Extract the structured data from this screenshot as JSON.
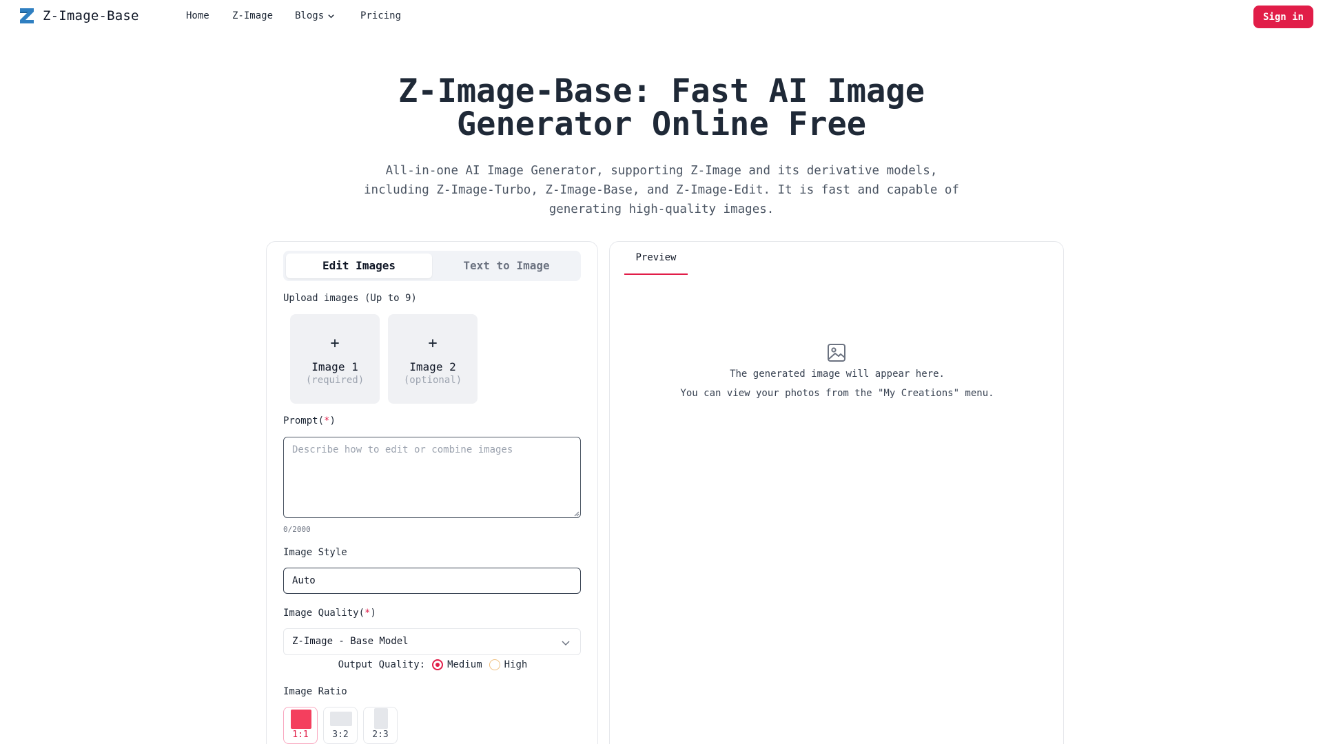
{
  "nav": {
    "brand": "Z-Image-Base",
    "links": [
      {
        "label": "Home"
      },
      {
        "label": "Z-Image"
      },
      {
        "label": "Blogs"
      },
      {
        "label": "Pricing"
      }
    ],
    "signin_label": "Sign in"
  },
  "hero": {
    "title_line1": "Z-Image-Base: Fast AI Image",
    "title_line2": "Generator Online Free",
    "subtitle_line1": "All-in-one AI Image Generator, supporting Z-Image and its derivative models,",
    "subtitle_line2": "including Z-Image-Turbo, Z-Image-Base, and Z-Image-Edit. It is fast and capable of",
    "subtitle_line3": "generating high-quality images."
  },
  "editor": {
    "tabs": [
      {
        "label": "Edit Images",
        "active": true
      },
      {
        "label": "Text to Image",
        "active": false
      }
    ],
    "upload_label": "Upload images (Up to 9)",
    "uploads": [
      {
        "plus": "+",
        "title": "Image 1",
        "note": "(required)"
      },
      {
        "plus": "+",
        "title": "Image 2",
        "note": "(optional)"
      }
    ],
    "prompt_label": "Prompt(",
    "prompt_req": "*",
    "prompt_label_end": ")",
    "prompt_value": "",
    "prompt_placeholder": "Describe how to edit or combine images",
    "prompt_counter": "0/2000",
    "style_label": "Image Style",
    "style_value": "Auto",
    "quality_label": "Image Quality(",
    "quality_req": "*",
    "quality_label_end": ")",
    "quality_value": "Z-Image - Base Model",
    "output_quality_label": "Output Quality:",
    "output_options": [
      {
        "label": "Medium",
        "selected": true
      },
      {
        "label": "High",
        "selected": false
      }
    ],
    "ratio_label": "Image Ratio",
    "ratios": [
      {
        "label": "1:1",
        "selected": true
      },
      {
        "label": "3:2",
        "selected": false
      },
      {
        "label": "2:3",
        "selected": false
      }
    ]
  },
  "preview": {
    "tab_label": "Preview",
    "empty_line1": "The generated image will appear here.",
    "empty_line2": "You can view your photos from the \"My Creations\" menu."
  },
  "colors": {
    "accent": "#e11d48",
    "brand_blue": "#2f7fc1"
  },
  "icons": [
    "z-logo-icon",
    "chevron-down-icon",
    "image-placeholder-icon"
  ]
}
